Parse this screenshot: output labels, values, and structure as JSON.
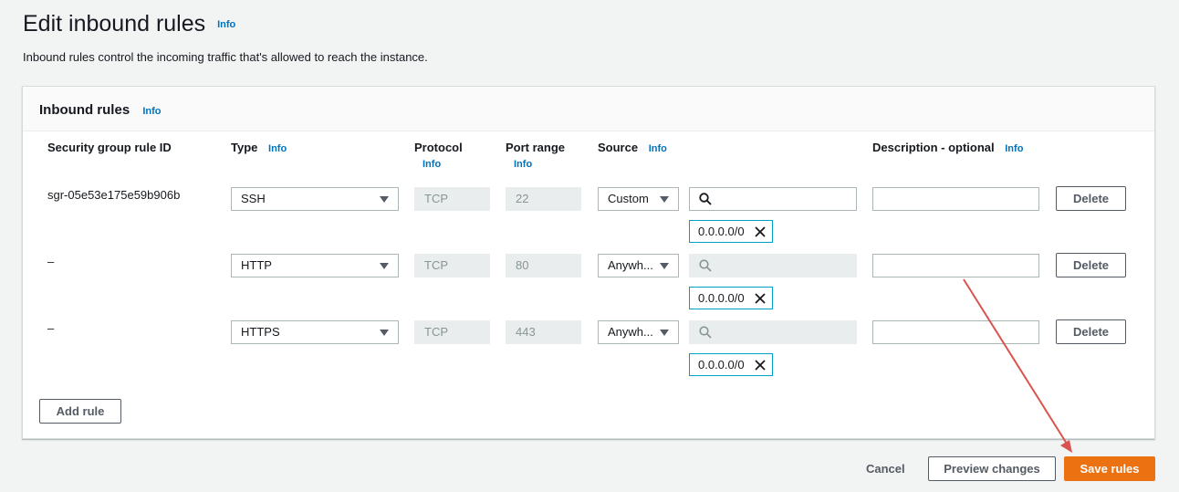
{
  "header": {
    "title": "Edit inbound rules",
    "info": "Info",
    "description": "Inbound rules control the incoming traffic that's allowed to reach the instance."
  },
  "panel": {
    "title": "Inbound rules",
    "info": "Info",
    "columns": {
      "rule_id": "Security group rule ID",
      "type": "Type",
      "type_info": "Info",
      "protocol": "Protocol",
      "protocol_info": "Info",
      "port_range": "Port range",
      "port_range_info": "Info",
      "source": "Source",
      "source_info": "Info",
      "description": "Description - optional",
      "description_info": "Info"
    },
    "rules": [
      {
        "id": "sgr-05e53e175e59b906b",
        "type": "SSH",
        "protocol": "TCP",
        "port": "22",
        "source": "Custom",
        "cidr": "0.0.0.0/0",
        "description": "",
        "delete": "Delete"
      },
      {
        "id": "–",
        "type": "HTTP",
        "protocol": "TCP",
        "port": "80",
        "source": "Anywh...",
        "cidr": "0.0.0.0/0",
        "description": "",
        "delete": "Delete"
      },
      {
        "id": "–",
        "type": "HTTPS",
        "protocol": "TCP",
        "port": "443",
        "source": "Anywh...",
        "cidr": "0.0.0.0/0",
        "description": "",
        "delete": "Delete"
      }
    ],
    "add_rule": "Add rule"
  },
  "footer": {
    "cancel": "Cancel",
    "preview": "Preview changes",
    "save": "Save rules"
  },
  "colors": {
    "primary": "#ec7211",
    "link": "#0073bb",
    "token_border": "#00a1c9",
    "annotation_arrow": "#d9534f"
  }
}
